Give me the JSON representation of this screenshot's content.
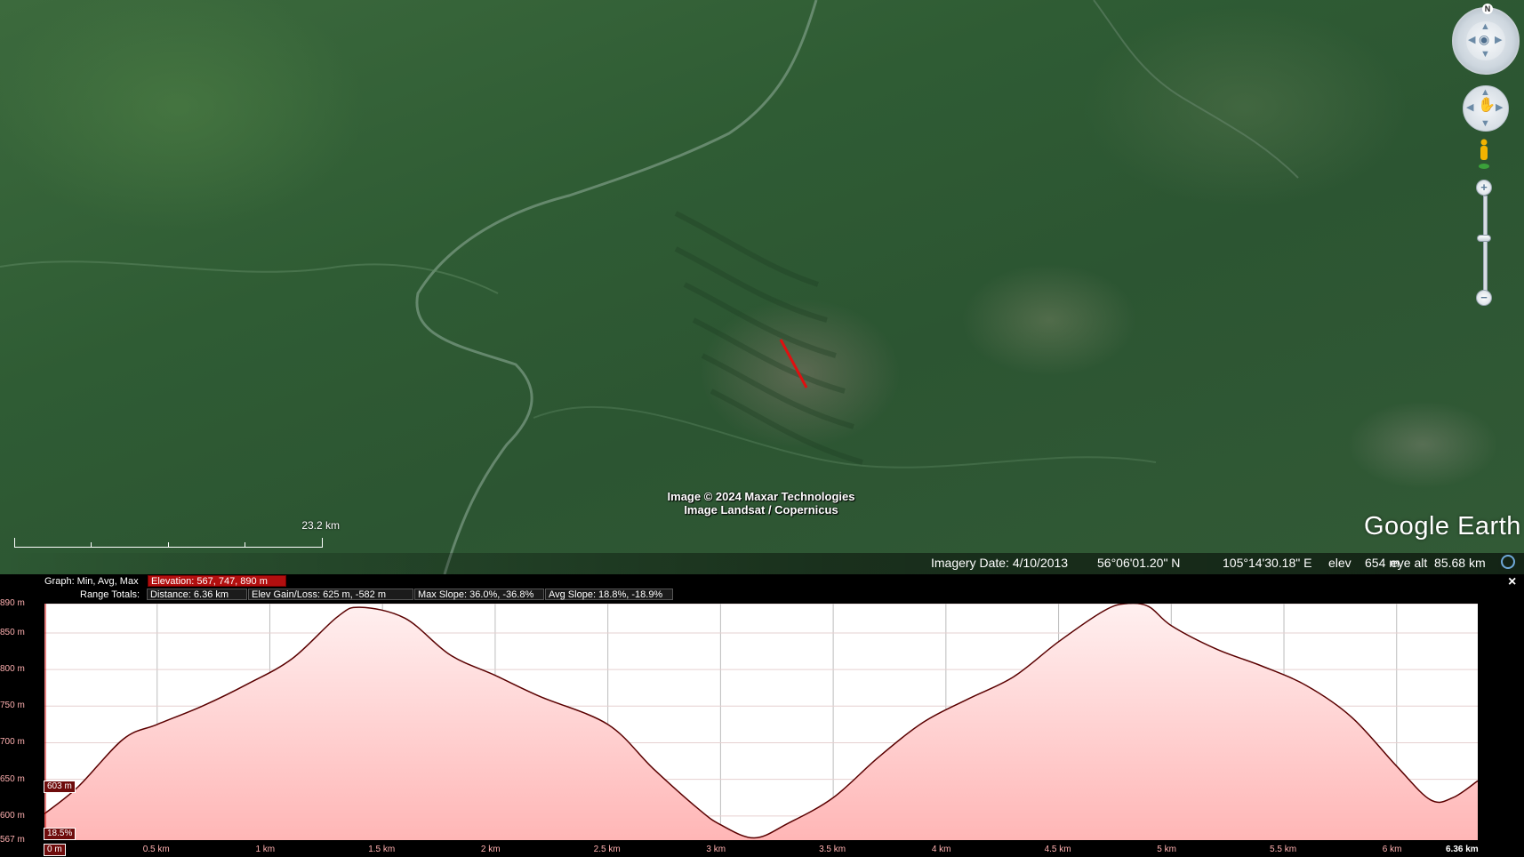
{
  "map": {
    "copyright_line1": "Image © 2024 Maxar Technologies",
    "copyright_line2": "Image Landsat / Copernicus",
    "scale_label": "23.2 km",
    "logo": "Google Earth"
  },
  "status": {
    "imagery_date": "Imagery Date: 4/10/2013",
    "latitude": "56°06'01.20\" N",
    "longitude": "105°14'30.18\" E",
    "elev_label": "elev",
    "elev_value": "654 m",
    "eye_alt": "eye alt  85.68 km"
  },
  "nav": {
    "north": "N",
    "zoom_in": "+",
    "zoom_out": "−"
  },
  "profile": {
    "graph_label": "Graph: Min, Avg, Max",
    "elevation_stats": "Elevation: 567, 747, 890 m",
    "range_totals_label": "Range Totals:",
    "distance": "Distance: 6.36 km",
    "elev_gain_loss": "Elev Gain/Loss: 625 m, -582 m",
    "max_slope": "Max Slope: 36.0%, -36.8%",
    "avg_slope": "Avg Slope: 18.8%, -18.9%",
    "close": "×",
    "cursor_elev": "603 m",
    "cursor_slope": "18.5%",
    "cursor_dist": "0 m"
  },
  "chart_data": {
    "type": "area",
    "title": "",
    "xlabel": "",
    "ylabel": "",
    "xlim": [
      0,
      6.36
    ],
    "ylim": [
      567,
      890
    ],
    "y_ticks": [
      "890 m",
      "850 m",
      "800 m",
      "750 m",
      "700 m",
      "650 m",
      "600 m",
      "567 m"
    ],
    "x_ticks": [
      "0 m",
      "0.5 km",
      "1 km",
      "1.5 km",
      "2 km",
      "2.5 km",
      "3 km",
      "3.5 km",
      "4 km",
      "4.5 km",
      "5 km",
      "5.5 km",
      "6 km",
      "6.36 km"
    ],
    "series": [
      {
        "x": [
          0,
          0.15,
          0.35,
          0.5,
          0.7,
          0.9,
          1.1,
          1.3,
          1.4,
          1.6,
          1.8,
          2.0,
          2.2,
          2.5,
          2.7,
          2.9,
          3.0,
          3.15,
          3.3,
          3.5,
          3.7,
          3.9,
          4.1,
          4.3,
          4.5,
          4.7,
          4.8,
          4.9,
          5.0,
          5.2,
          5.4,
          5.6,
          5.8,
          6.0,
          6.15,
          6.25,
          6.36
        ],
        "values": [
          603,
          640,
          705,
          725,
          750,
          780,
          815,
          872,
          885,
          870,
          820,
          792,
          763,
          725,
          665,
          610,
          588,
          570,
          590,
          625,
          680,
          728,
          760,
          790,
          838,
          880,
          890,
          886,
          860,
          828,
          805,
          778,
          735,
          668,
          622,
          625,
          648
        ]
      }
    ],
    "colors": {
      "fill": "#ffb6b6",
      "line": "#5a0000",
      "grid": "#bcbcbc"
    }
  }
}
